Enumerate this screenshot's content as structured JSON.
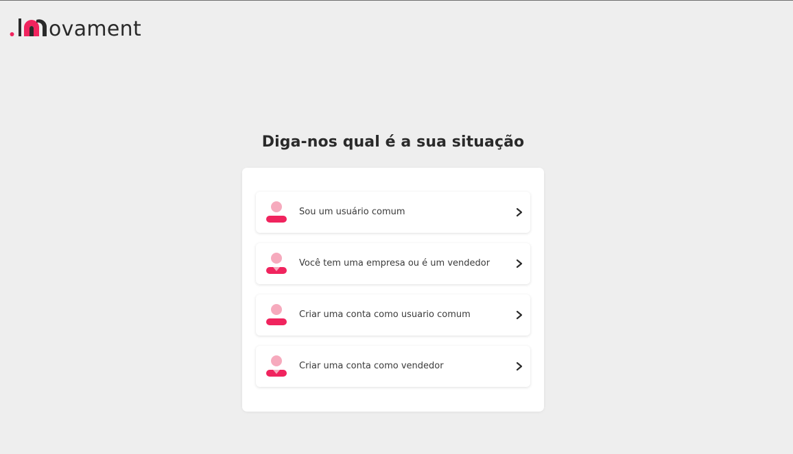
{
  "brand": {
    "logo_text": "ovament",
    "accent_color": "#f0245e",
    "soft_color": "#f6aabd",
    "dark_color": "#2a2a2a"
  },
  "page": {
    "title": "Diga-nos qual é a sua situação"
  },
  "options": [
    {
      "label": "Sou um usuário comum",
      "icon": "user-icon"
    },
    {
      "label": "Você tem uma empresa ou é um vendedor",
      "icon": "seller-icon"
    },
    {
      "label": "Criar uma conta como usuario comum",
      "icon": "user-icon"
    },
    {
      "label": "Criar uma conta como vendedor",
      "icon": "seller-icon"
    }
  ]
}
